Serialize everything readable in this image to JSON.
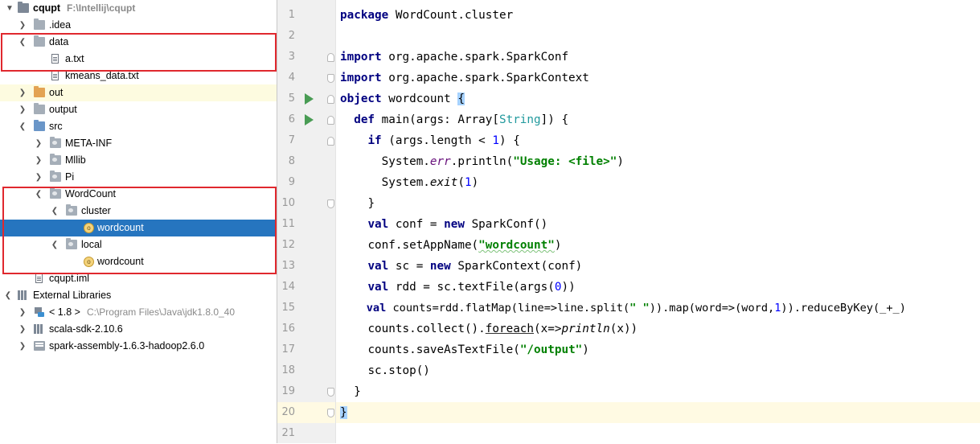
{
  "project_tree": {
    "root": {
      "label": "cqupt",
      "path": "F:\\Intellij\\cqupt"
    },
    "idea": ".idea",
    "data": "data",
    "a_txt": "a.txt",
    "kmeans": "kmeans_data.txt",
    "out": "out",
    "output": "output",
    "src": "src",
    "meta_inf": "META-INF",
    "mllib": "Mllib",
    "pi": "Pi",
    "wordcount_pkg": "WordCount",
    "cluster": "cluster",
    "wordcount_cluster": "wordcount",
    "local": "local",
    "wordcount_local": "wordcount",
    "iml": "cqupt.iml",
    "ext_libs": "External Libraries",
    "jdk": {
      "label": "< 1.8 >",
      "path": "C:\\Program Files\\Java\\jdk1.8.0_40"
    },
    "scala_sdk": "scala-sdk-2.10.6",
    "spark_assembly": "spark-assembly-1.6.3-hadoop2.6.0",
    "highlight_color": "#e0282e",
    "selection_color": "#2675bf"
  },
  "editor": {
    "current_line": 20,
    "line_numbers": [
      "1",
      "2",
      "3",
      "4",
      "5",
      "6",
      "7",
      "8",
      "9",
      "10",
      "11",
      "12",
      "13",
      "14",
      "15",
      "16",
      "17",
      "18",
      "19",
      "20",
      "21"
    ],
    "lines": {
      "l1": {
        "kw": "package",
        "rest": " WordCount.cluster"
      },
      "l3": {
        "kw": "import",
        "rest": " org.apache.spark.SparkConf"
      },
      "l4": {
        "kw": "import",
        "rest": " org.apache.spark.SparkContext"
      },
      "l5": {
        "kw": "object",
        "name": " wordcount ",
        "brace": "{"
      },
      "l6": {
        "kw": "def",
        "a": " main(args: Array[",
        "type": "String",
        "b": "]) {"
      },
      "l7": {
        "kw": "if",
        "a": " (args.length < ",
        "num": "1",
        "b": ") {"
      },
      "l8": {
        "a": "System.",
        "err": "err",
        "b": ".println(",
        "str": "\"Usage: <file>\"",
        "c": ")"
      },
      "l9": {
        "a": "System.",
        "exit": "exit",
        "b": "(",
        "num": "1",
        "c": ")"
      },
      "l10": {
        "a": "}"
      },
      "l11": {
        "kw": "val",
        "a": " conf = ",
        "kw2": "new",
        "b": " SparkConf()"
      },
      "l12": {
        "a": "conf.setAppName(",
        "str": "\"wordcount\"",
        "b": ")"
      },
      "l13": {
        "kw": "val",
        "a": " sc = ",
        "kw2": "new",
        "b": " SparkContext(conf)"
      },
      "l14": {
        "kw": "val",
        "a": " rdd = sc.textFile(args(",
        "num": "0",
        "b": "))"
      },
      "l15": {
        "kw": "val",
        "a": " counts=rdd.flatMap(line=>line.split(",
        "str": "\" \"",
        "b": ")).map(word=>(word,",
        "num": "1",
        "c": ")).reduceByKey(_+_)"
      },
      "l16": {
        "a": "counts.collect().",
        "fe": "foreach",
        "b": "(x=>",
        "pl": "println",
        "c": "(x))"
      },
      "l17": {
        "a": "counts.saveAsTextFile(",
        "str": "\"/output\"",
        "b": ")"
      },
      "l18": {
        "a": "sc.stop()"
      },
      "l19": {
        "a": "}"
      },
      "l20": {
        "brace": "}"
      }
    }
  }
}
